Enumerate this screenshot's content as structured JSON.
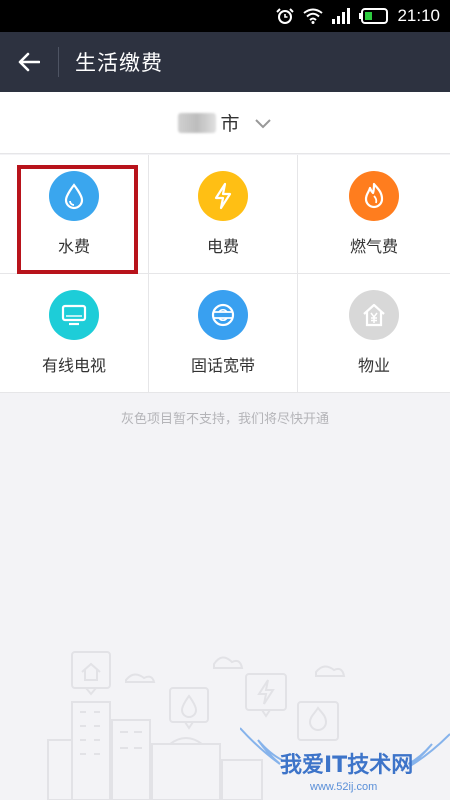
{
  "status_bar": {
    "time": "21:10"
  },
  "header": {
    "title": "生活缴费"
  },
  "city": {
    "suffix": "市"
  },
  "services": [
    {
      "label": "水费",
      "icon": "water-drop-icon",
      "color": "#3aa6ee"
    },
    {
      "label": "电费",
      "icon": "lightning-icon",
      "color": "#ffbf14"
    },
    {
      "label": "燃气费",
      "icon": "flame-icon",
      "color": "#ff7d1e"
    },
    {
      "label": "有线电视",
      "icon": "tv-icon",
      "color": "#1dcdd8"
    },
    {
      "label": "固话宽带",
      "icon": "broadband-icon",
      "color": "#39a0f0"
    },
    {
      "label": "物业",
      "icon": "property-house-icon",
      "color": "#d8d8d8"
    }
  ],
  "note": "灰色项目暂不支持，我们将尽快开通",
  "watermark": {
    "title": "我爱IT技术网",
    "url": "www.52ij.com"
  }
}
